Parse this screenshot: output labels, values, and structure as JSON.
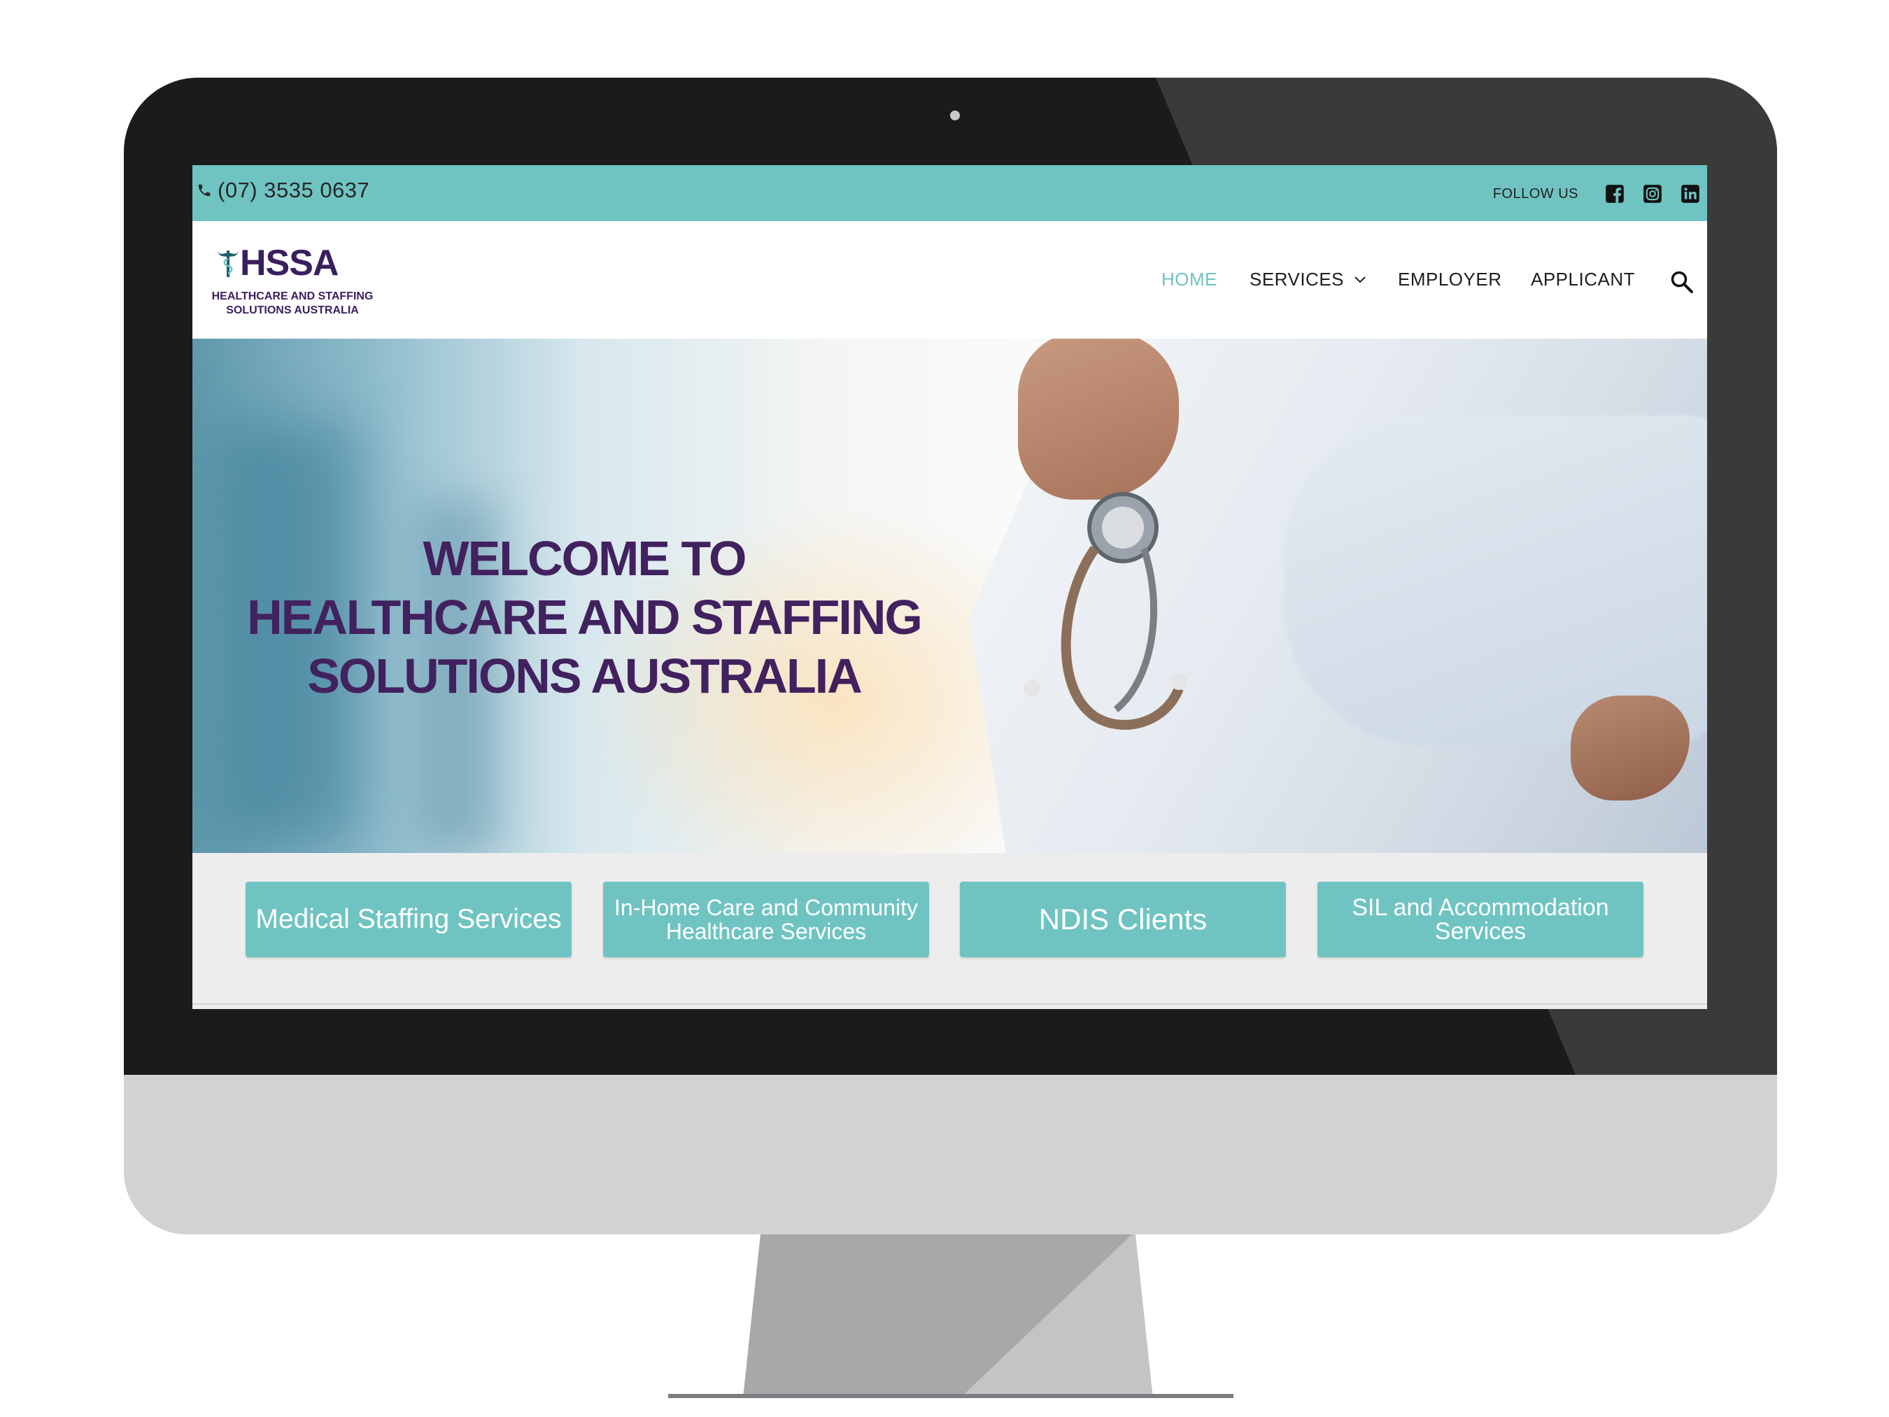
{
  "topbar": {
    "phone": "(07) 3535 0637",
    "follow_label": "FOLLOW US",
    "social": [
      "facebook-icon",
      "instagram-icon",
      "linkedin-icon"
    ]
  },
  "header": {
    "logo_title": "HSSA",
    "logo_subtitle_line1": "HEALTHCARE AND STAFFING",
    "logo_subtitle_line2": "SOLUTIONS AUSTRALIA",
    "nav": {
      "home": "HOME",
      "services": "SERVICES",
      "employer": "EMPLOYER",
      "applicant": "APPLICANT"
    }
  },
  "hero": {
    "line1": "WELCOME TO",
    "line2": "HEALTHCARE AND STAFFING",
    "line3": "SOLUTIONS AUSTRALIA"
  },
  "services": {
    "medical": "Medical Staffing Services",
    "inhome_line1": "In-Home Care and Community",
    "inhome_line2": "Healthcare Services",
    "ndis": "NDIS Clients",
    "sil_line1": "SIL and Accommodation",
    "sil_line2": "Services"
  },
  "colors": {
    "accent": "#6fc4c2",
    "brand_purple": "#42215f",
    "bezel": "#1b1b1b",
    "chin": "#d1d2d4"
  }
}
